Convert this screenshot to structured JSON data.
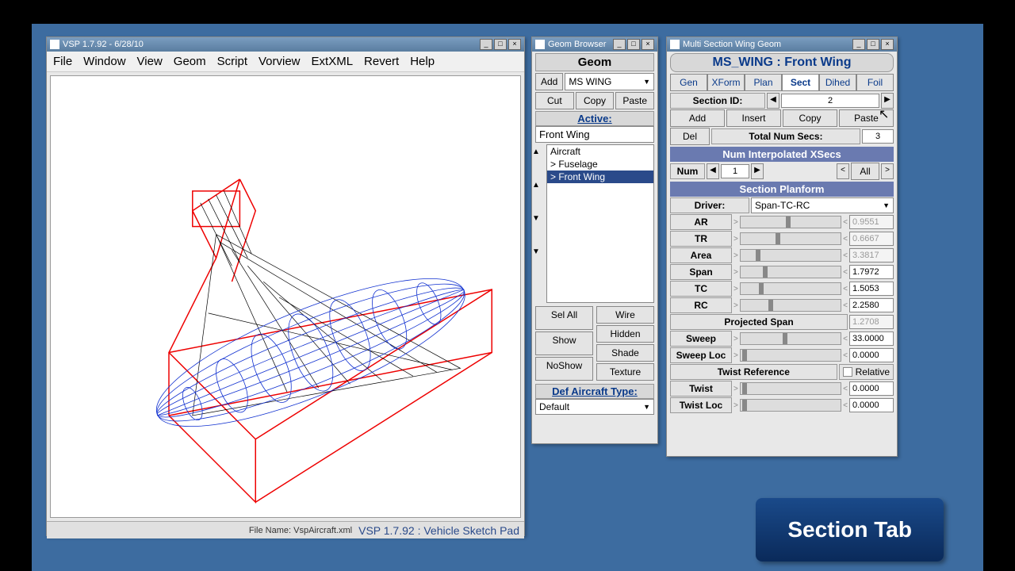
{
  "main_window": {
    "title": "VSP 1.7.92 - 6/28/10",
    "menu": [
      "File",
      "Window",
      "View",
      "Geom",
      "Script",
      "Vorview",
      "ExtXML",
      "Revert",
      "Help"
    ],
    "file_name_label": "File Name:",
    "file_name": "VspAircraft.xml",
    "app_label": "VSP 1.7.92 : Vehicle Sketch Pad"
  },
  "geom_browser": {
    "title": "Geom Browser",
    "header": "Geom",
    "add": "Add",
    "type": "MS WING",
    "cut": "Cut",
    "copy": "Copy",
    "paste": "Paste",
    "active_label": "Active:",
    "active_value": "Front Wing",
    "tree": [
      "Aircraft",
      "> Fuselage",
      "> Front Wing"
    ],
    "tree_selected": 2,
    "sel_all": "Sel All",
    "show": "Show",
    "noshow": "NoShow",
    "wire": "Wire",
    "hidden": "Hidden",
    "shade": "Shade",
    "texture": "Texture",
    "def_label": "Def Aircraft Type:",
    "def_value": "Default"
  },
  "multi_section": {
    "title": "Multi Section Wing Geom",
    "subtitle": "MS_WING : Front Wing",
    "tabs": [
      "Gen",
      "XForm",
      "Plan",
      "Sect",
      "Dihed",
      "Foil"
    ],
    "active_tab": 3,
    "section_id_label": "Section ID:",
    "section_id": "2",
    "add": "Add",
    "insert": "Insert",
    "copy": "Copy",
    "paste": "Paste",
    "del": "Del",
    "total_secs_label": "Total Num Secs:",
    "total_secs": "3",
    "interp_header": "Num Interpolated XSecs",
    "num_label": "Num",
    "num_value": "1",
    "all": "All",
    "planform_header": "Section Planform",
    "driver_label": "Driver:",
    "driver_value": "Span-TC-RC",
    "params": [
      {
        "label": "AR",
        "value": "0.9551",
        "disabled": true,
        "pos": 45
      },
      {
        "label": "TR",
        "value": "0.6667",
        "disabled": true,
        "pos": 35
      },
      {
        "label": "Area",
        "value": "3.3817",
        "disabled": true,
        "pos": 15
      },
      {
        "label": "Span",
        "value": "1.7972",
        "disabled": false,
        "pos": 22
      },
      {
        "label": "TC",
        "value": "1.5053",
        "disabled": false,
        "pos": 18
      },
      {
        "label": "RC",
        "value": "2.2580",
        "disabled": false,
        "pos": 28
      }
    ],
    "proj_span_label": "Projected Span",
    "proj_span": "1.2708",
    "sweep_label": "Sweep",
    "sweep": "33.0000",
    "sweep_loc_label": "Sweep Loc",
    "sweep_loc": "0.0000",
    "twist_ref_label": "Twist Reference",
    "relative_label": "Relative",
    "twist_label": "Twist",
    "twist": "0.0000",
    "twist_loc_label": "Twist Loc",
    "twist_loc": "0.0000"
  },
  "caption": "Section Tab"
}
